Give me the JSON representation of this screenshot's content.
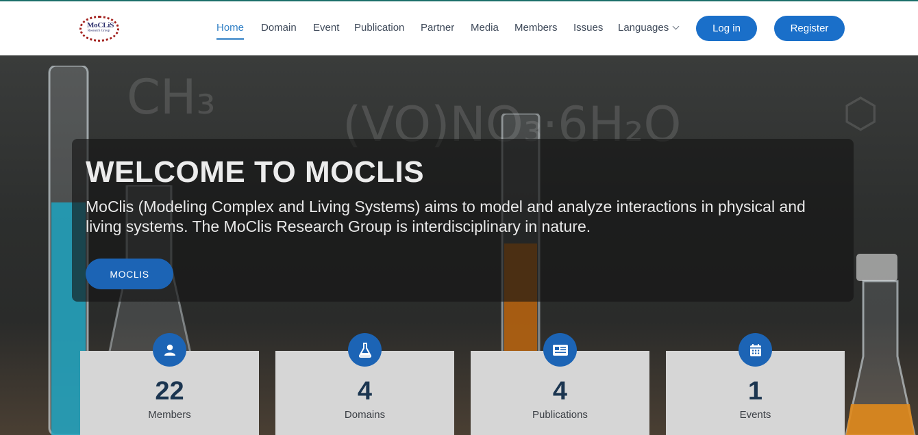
{
  "header": {
    "logo": {
      "text": "MoCLiS",
      "subtext": "Research Group"
    },
    "nav": [
      "Home",
      "Domain",
      "Event",
      "Publication",
      "Partner",
      "Media",
      "Members",
      "Issues",
      "Languages"
    ],
    "login_label": "Log in",
    "register_label": "Register"
  },
  "hero": {
    "title": "WELCOME TO MOCLIS",
    "description": "MoClis (Modeling Complex and Living Systems) aims to model and analyze interactions in physical and living systems. The MoClis Research Group is interdisciplinary in nature.",
    "button_label": "MOCLIS"
  },
  "stats": [
    {
      "value": "22",
      "label": "Members",
      "icon": "user-icon"
    },
    {
      "value": "4",
      "label": "Domains",
      "icon": "flask-icon"
    },
    {
      "value": "4",
      "label": "Publications",
      "icon": "newspaper-icon"
    },
    {
      "value": "1",
      "label": "Events",
      "icon": "calendar-icon"
    }
  ],
  "colors": {
    "accent": "#1a6fc9",
    "nav_active": "#2f7fc5",
    "card_bg": "#d6d6d6"
  }
}
